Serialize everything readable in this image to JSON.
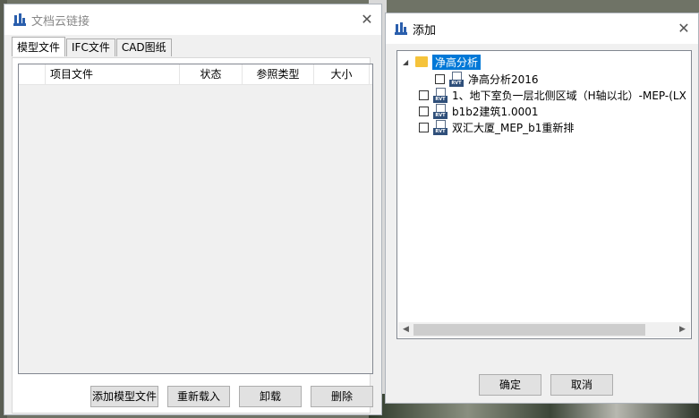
{
  "left_window": {
    "title": "文档云链接",
    "tabs": [
      "模型文件",
      "IFC文件",
      "CAD图纸"
    ],
    "columns": [
      "",
      "项目文件",
      "状态",
      "参照类型",
      "大小"
    ],
    "buttons": {
      "add_model": "添加模型文件",
      "reload": "重新载入",
      "unload": "卸载",
      "delete": "删除"
    }
  },
  "right_window": {
    "title": "添加",
    "tree": {
      "root_label": "净高分析",
      "root_expander": "◢",
      "items": [
        {
          "label": "净高分析2016",
          "checked": false
        },
        {
          "label": "1、地下室负一层北侧区域（H轴以北）-MEP-(LX",
          "checked": false
        },
        {
          "label": "b1b2建筑1.0001",
          "checked": false
        },
        {
          "label": "双汇大厦_MEP_b1重新排",
          "checked": false
        }
      ],
      "file_tag": "RVT"
    },
    "buttons": {
      "ok": "确定",
      "cancel": "取消"
    }
  },
  "glyphs": {
    "close": "✕",
    "scroll_left": "◀",
    "scroll_right": "▶"
  },
  "colors": {
    "selection": "#0078d7",
    "folder": "#f5c33b",
    "app_icon": "#2b5fad"
  }
}
